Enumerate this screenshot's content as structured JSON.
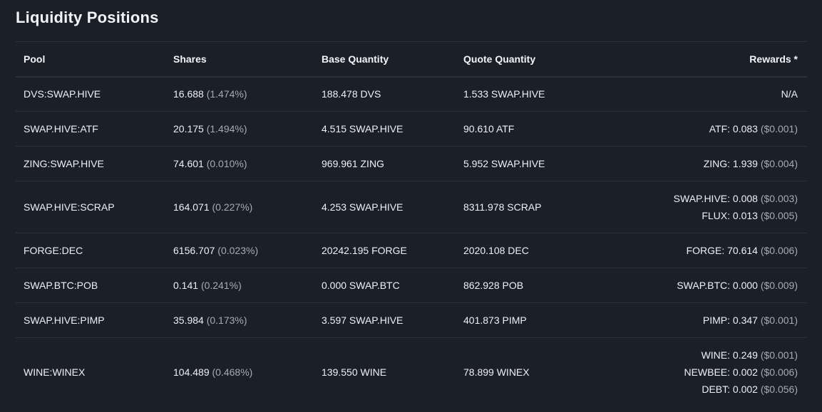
{
  "title": "Liquidity Positions",
  "columns": {
    "pool": "Pool",
    "shares": "Shares",
    "base_quantity": "Base Quantity",
    "quote_quantity": "Quote Quantity",
    "rewards": "Rewards *"
  },
  "rows": [
    {
      "pool": "DVS:SWAP.HIVE",
      "shares": "16.688",
      "shares_pct": "(1.474%)",
      "base": "188.478 DVS",
      "quote": "1.533 SWAP.HIVE",
      "rewards": [
        {
          "amount": "N/A",
          "usd": ""
        }
      ]
    },
    {
      "pool": "SWAP.HIVE:ATF",
      "shares": "20.175",
      "shares_pct": "(1.494%)",
      "base": "4.515 SWAP.HIVE",
      "quote": "90.610 ATF",
      "rewards": [
        {
          "amount": "ATF: 0.083",
          "usd": "($0.001)"
        }
      ]
    },
    {
      "pool": "ZING:SWAP.HIVE",
      "shares": "74.601",
      "shares_pct": "(0.010%)",
      "base": "969.961 ZING",
      "quote": "5.952 SWAP.HIVE",
      "rewards": [
        {
          "amount": "ZING: 1.939",
          "usd": "($0.004)"
        }
      ]
    },
    {
      "pool": "SWAP.HIVE:SCRAP",
      "shares": "164.071",
      "shares_pct": "(0.227%)",
      "base": "4.253 SWAP.HIVE",
      "quote": "8311.978 SCRAP",
      "rewards": [
        {
          "amount": "SWAP.HIVE: 0.008",
          "usd": "($0.003)"
        },
        {
          "amount": "FLUX: 0.013",
          "usd": "($0.005)"
        }
      ]
    },
    {
      "pool": "FORGE:DEC",
      "shares": "6156.707",
      "shares_pct": "(0.023%)",
      "base": "20242.195 FORGE",
      "quote": "2020.108 DEC",
      "rewards": [
        {
          "amount": "FORGE: 70.614",
          "usd": "($0.006)"
        }
      ]
    },
    {
      "pool": "SWAP.BTC:POB",
      "shares": "0.141",
      "shares_pct": "(0.241%)",
      "base": "0.000 SWAP.BTC",
      "quote": "862.928 POB",
      "rewards": [
        {
          "amount": "SWAP.BTC: 0.000",
          "usd": "($0.009)"
        }
      ]
    },
    {
      "pool": "SWAP.HIVE:PIMP",
      "shares": "35.984",
      "shares_pct": "(0.173%)",
      "base": "3.597 SWAP.HIVE",
      "quote": "401.873 PIMP",
      "rewards": [
        {
          "amount": "PIMP: 0.347",
          "usd": "($0.001)"
        }
      ]
    },
    {
      "pool": "WINE:WINEX",
      "shares": "104.489",
      "shares_pct": "(0.468%)",
      "base": "139.550 WINE",
      "quote": "78.899 WINEX",
      "rewards": [
        {
          "amount": "WINE: 0.249",
          "usd": "($0.001)"
        },
        {
          "amount": "NEWBEE: 0.002",
          "usd": "($0.006)"
        },
        {
          "amount": "DEBT: 0.002",
          "usd": "($0.056)"
        }
      ]
    }
  ]
}
